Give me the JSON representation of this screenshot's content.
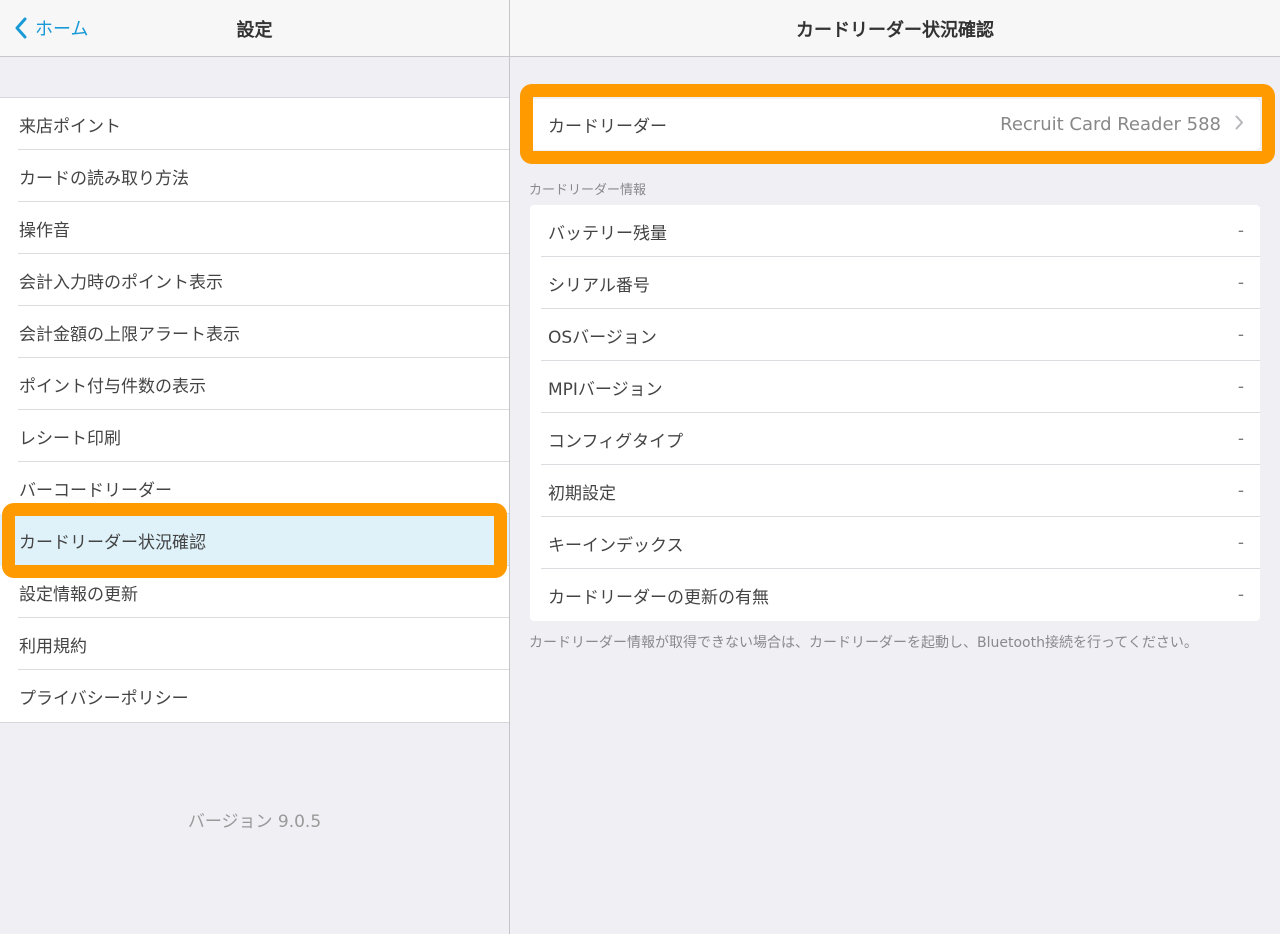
{
  "left": {
    "back_label": "ホーム",
    "title": "設定",
    "items": [
      {
        "label": "来店ポイント"
      },
      {
        "label": "カードの読み取り方法"
      },
      {
        "label": "操作音"
      },
      {
        "label": "会計入力時のポイント表示"
      },
      {
        "label": "会計金額の上限アラート表示"
      },
      {
        "label": "ポイント付与件数の表示"
      },
      {
        "label": "レシート印刷"
      },
      {
        "label": "バーコードリーダー"
      },
      {
        "label": "カードリーダー状況確認"
      },
      {
        "label": "設定情報の更新"
      },
      {
        "label": "利用規約"
      },
      {
        "label": "プライバシーポリシー"
      }
    ],
    "selected_index": 8,
    "version": "バージョン 9.0.5"
  },
  "right": {
    "title": "カードリーダー状況確認",
    "reader": {
      "label": "カードリーダー",
      "value": "Recruit Card Reader 588"
    },
    "section_header": "カードリーダー情報",
    "info_rows": [
      {
        "label": "バッテリー残量",
        "value": "-"
      },
      {
        "label": "シリアル番号",
        "value": "-"
      },
      {
        "label": "OSバージョン",
        "value": "-"
      },
      {
        "label": "MPIバージョン",
        "value": "-"
      },
      {
        "label": "コンフィグタイプ",
        "value": "-"
      },
      {
        "label": "初期設定",
        "value": "-"
      },
      {
        "label": "キーインデックス",
        "value": "-"
      },
      {
        "label": "カードリーダーの更新の有無",
        "value": "-"
      }
    ],
    "footer_note": "カードリーダー情報が取得できない場合は、カードリーダーを起動し、Bluetooth接続を行ってください。"
  },
  "colors": {
    "accent": "#1a9ad6",
    "highlight": "#ff9a00",
    "selected_row": "#dff2fa"
  }
}
